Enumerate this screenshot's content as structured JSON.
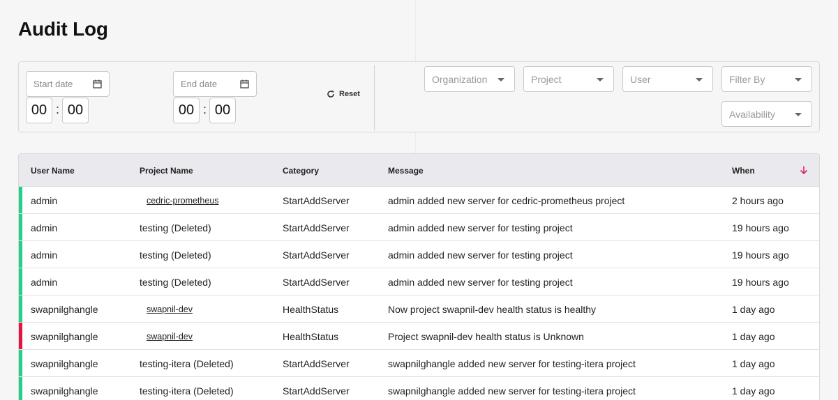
{
  "page": {
    "title": "Audit Log"
  },
  "filters": {
    "start_date_placeholder": "Start date",
    "end_date_placeholder": "End date",
    "start_hour": "00",
    "start_minute": "00",
    "end_hour": "00",
    "end_minute": "00",
    "time_separator": ":",
    "reset_label": "Reset",
    "organization_placeholder": "Organization",
    "project_placeholder": "Project",
    "user_placeholder": "User",
    "filter_by_placeholder": "Filter By",
    "availability_placeholder": "Availability"
  },
  "table": {
    "columns": {
      "user_name": "User Name",
      "project_name": "Project Name",
      "category": "Category",
      "message": "Message",
      "when": "When"
    },
    "sort": {
      "column": "When",
      "direction": "descending",
      "icon": "arrow-down-icon",
      "color": "#e0245e"
    },
    "status_colors": {
      "success": "#1fd18a",
      "error": "#e8123c"
    },
    "rows": [
      {
        "status": "success",
        "user": "admin",
        "project": "cedric-prometheus",
        "project_link": true,
        "category": "StartAddServer",
        "message": "admin added new server for cedric-prometheus project",
        "when": "2 hours ago"
      },
      {
        "status": "success",
        "user": "admin",
        "project": "testing  (Deleted)",
        "project_link": false,
        "category": "StartAddServer",
        "message": "admin added new server for testing project",
        "when": "19 hours ago"
      },
      {
        "status": "success",
        "user": "admin",
        "project": "testing  (Deleted)",
        "project_link": false,
        "category": "StartAddServer",
        "message": "admin added new server for testing project",
        "when": "19 hours ago"
      },
      {
        "status": "success",
        "user": "admin",
        "project": "testing  (Deleted)",
        "project_link": false,
        "category": "StartAddServer",
        "message": "admin added new server for testing project",
        "when": "19 hours ago"
      },
      {
        "status": "success",
        "user": "swapnilghangle",
        "project": "swapnil-dev",
        "project_link": true,
        "category": "HealthStatus",
        "message": "Now project swapnil-dev health status is healthy",
        "when": "1 day ago"
      },
      {
        "status": "error",
        "user": "swapnilghangle",
        "project": "swapnil-dev",
        "project_link": true,
        "category": "HealthStatus",
        "message": "Project swapnil-dev health status is Unknown",
        "when": "1 day ago"
      },
      {
        "status": "success",
        "user": "swapnilghangle",
        "project": "testing-itera  (Deleted)",
        "project_link": false,
        "category": "StartAddServer",
        "message": "swapnilghangle added new server for testing-itera project",
        "when": "1 day ago"
      },
      {
        "status": "success",
        "user": "swapnilghangle",
        "project": "testing-itera  (Deleted)",
        "project_link": false,
        "category": "StartAddServer",
        "message": "swapnilghangle added new server for testing-itera project",
        "when": "1 day ago"
      }
    ]
  }
}
